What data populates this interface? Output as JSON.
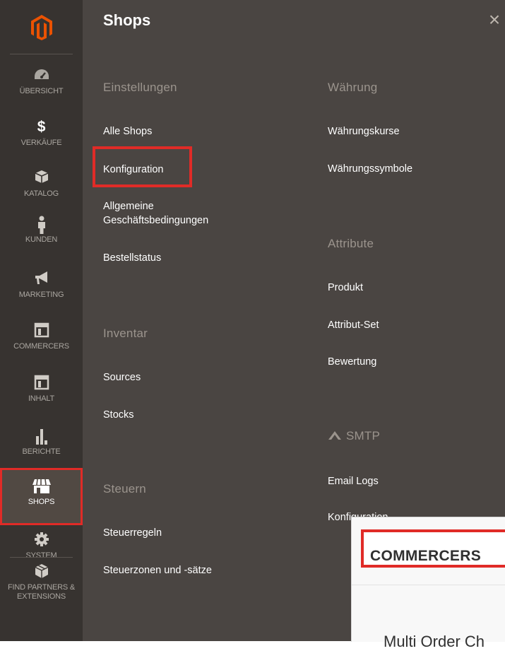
{
  "sidebar": {
    "items": [
      {
        "label": "ÜBERSICHT",
        "icon": "dashboard-icon"
      },
      {
        "label": "VERKÄUFE",
        "icon": "dollar-icon"
      },
      {
        "label": "KATALOG",
        "icon": "box-icon"
      },
      {
        "label": "KUNDEN",
        "icon": "person-icon"
      },
      {
        "label": "MARKETING",
        "icon": "megaphone-icon"
      },
      {
        "label": "COMMERCERS",
        "icon": "layout-icon"
      },
      {
        "label": "INHALT",
        "icon": "layout-icon"
      },
      {
        "label": "BERICHTE",
        "icon": "bar-chart-icon"
      },
      {
        "label": "SHOPS",
        "icon": "store-icon",
        "active": true
      },
      {
        "label": "SYSTEM",
        "icon": "gear-icon"
      },
      {
        "label": "FIND PARTNERS & EXTENSIONS",
        "icon": "cube-icon"
      }
    ]
  },
  "panel": {
    "title": "Shops",
    "close": "×",
    "left_column": {
      "einstellungen": {
        "title": "Einstellungen",
        "items": [
          "Alle Shops",
          "Konfiguration",
          "Allgemeine Geschäftsbedingungen",
          "Bestellstatus"
        ]
      },
      "inventar": {
        "title": "Inventar",
        "items": [
          "Sources",
          "Stocks"
        ]
      },
      "steuern": {
        "title": "Steuern",
        "items": [
          "Steuerregeln",
          "Steuerzonen und -sätze"
        ]
      }
    },
    "right_column": {
      "waehrung": {
        "title": "Währung",
        "items": [
          "Währungskurse",
          "Währungssymbole"
        ]
      },
      "attribute": {
        "title": "Attribute",
        "items": [
          "Produkt",
          "Attribut-Set",
          "Bewertung"
        ]
      },
      "smtp": {
        "title": "SMTP",
        "items": [
          "Email Logs",
          "Konfiguration"
        ]
      }
    }
  },
  "overlay": {
    "header": "COMMERCERS",
    "text": "Multi Order Ch"
  },
  "colors": {
    "sidebar_bg": "#373330",
    "panel_bg": "#4a4542",
    "logo_orange": "#eb5202",
    "highlight_red": "#e02b27"
  }
}
